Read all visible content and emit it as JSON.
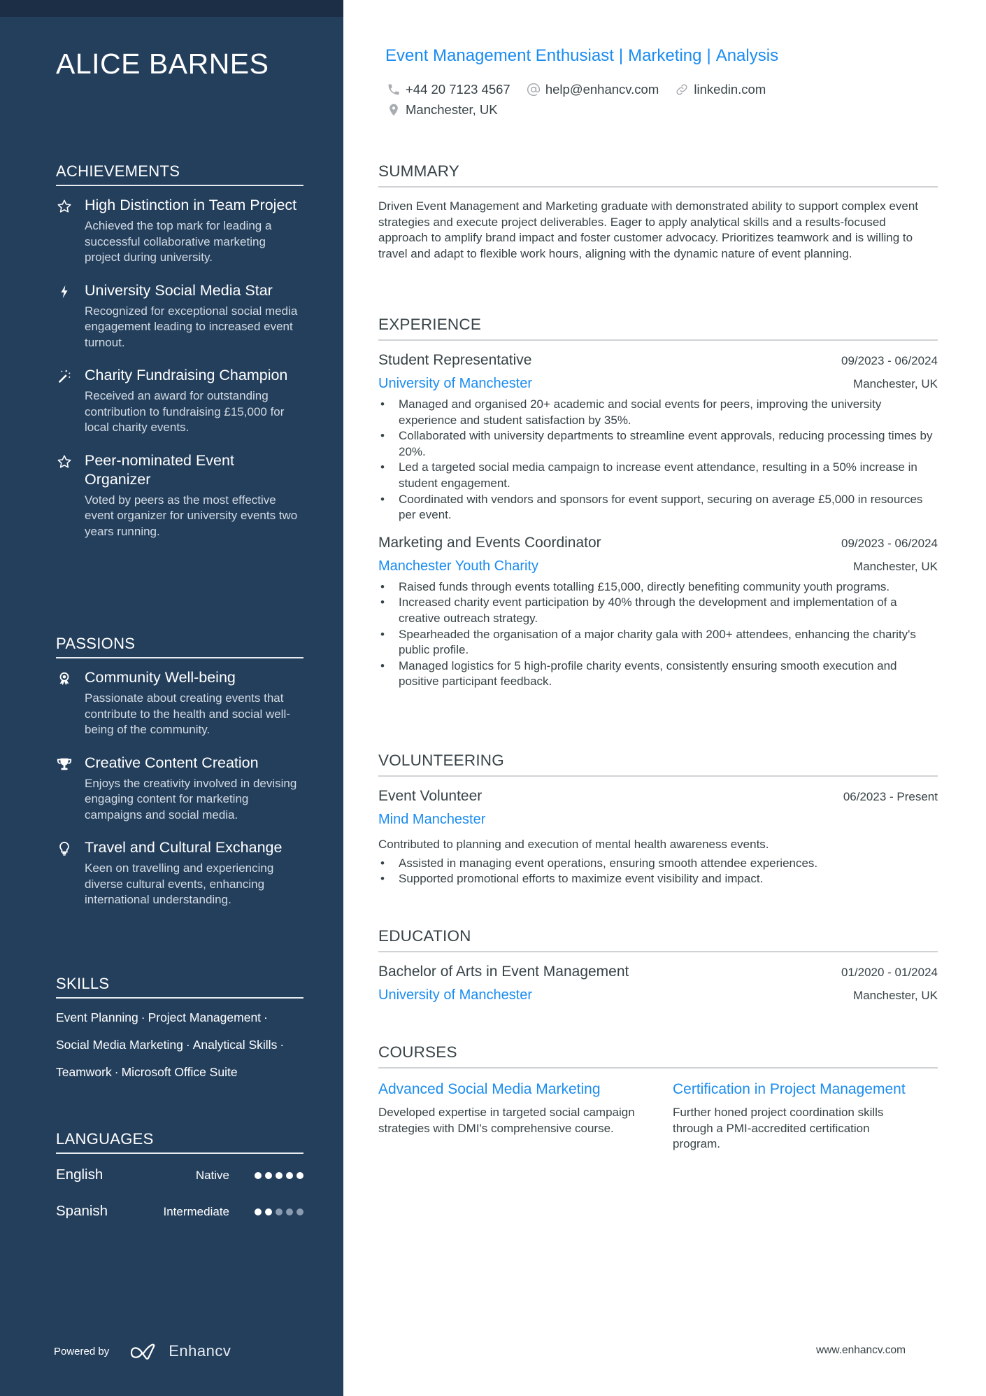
{
  "name": "ALICE BARNES",
  "headline": [
    "Event Management Enthusiast",
    "Marketing",
    "Analysis"
  ],
  "contacts": {
    "phone": "+44 20 7123 4567",
    "email": "help@enhancv.com",
    "link": "linkedin.com",
    "location": "Manchester, UK"
  },
  "sidebar": {
    "achievements": {
      "title": "ACHIEVEMENTS",
      "items": [
        {
          "icon": "star-icon",
          "title": "High Distinction in Team Project",
          "desc": "Achieved the top mark for leading a successful collaborative marketing project during university."
        },
        {
          "icon": "lightning-bolt-icon",
          "title": "University Social Media Star",
          "desc": "Recognized for exceptional social media engagement leading to increased event turnout."
        },
        {
          "icon": "magic-wand-icon",
          "title": "Charity Fundraising Champion",
          "desc": "Received an award for outstanding contribution to fundraising £15,000 for local charity events."
        },
        {
          "icon": "star-icon",
          "title": "Peer-nominated Event Organizer",
          "desc": "Voted by peers as the most effective event organizer for university events two years running."
        }
      ]
    },
    "passions": {
      "title": "PASSIONS",
      "items": [
        {
          "icon": "award-ribbon-icon",
          "title": "Community Well-being",
          "desc": "Passionate about creating events that contribute to the health and social well-being of the community."
        },
        {
          "icon": "trophy-icon",
          "title": "Creative Content Creation",
          "desc": "Enjoys the creativity involved in devising engaging content for marketing campaigns and social media."
        },
        {
          "icon": "lightbulb-icon",
          "title": "Travel and Cultural Exchange",
          "desc": "Keen on travelling and experiencing diverse cultural events, enhancing international understanding."
        }
      ]
    },
    "skills": {
      "title": "SKILLS",
      "items": [
        "Event Planning",
        "Project Management",
        "Social Media Marketing",
        "Analytical Skills",
        "Teamwork",
        "Microsoft Office Suite"
      ]
    },
    "languages": {
      "title": "LANGUAGES",
      "items": [
        {
          "name": "English",
          "level": "Native",
          "rating": 5,
          "max": 5
        },
        {
          "name": "Spanish",
          "level": "Intermediate",
          "rating": 2,
          "max": 5
        }
      ]
    },
    "powered_by": "Powered by",
    "brand": "Enhancv"
  },
  "main": {
    "summary": {
      "title": "SUMMARY",
      "text": "Driven Event Management and Marketing graduate with demonstrated ability to support complex event strategies and execute project deliverables. Eager to apply analytical skills and a results-focused approach to amplify brand impact and foster customer advocacy. Prioritizes teamwork and is willing to travel and adapt to flexible work hours, aligning with the dynamic nature of event planning."
    },
    "experience": {
      "title": "EXPERIENCE",
      "items": [
        {
          "role": "Student Representative",
          "dates": "09/2023 - 06/2024",
          "org": "University of Manchester",
          "location": "Manchester, UK",
          "bullets": [
            "Managed and organised 20+ academic and social events for peers, improving the university experience and student satisfaction by 35%.",
            "Collaborated with university departments to streamline event approvals, reducing processing times by 20%.",
            "Led a targeted social media campaign to increase event attendance, resulting in a 50% increase in student engagement.",
            "Coordinated with vendors and sponsors for event support, securing on average £5,000 in resources per event."
          ]
        },
        {
          "role": "Marketing and Events Coordinator",
          "dates": "09/2023 - 06/2024",
          "org": "Manchester Youth Charity",
          "location": "Manchester, UK",
          "bullets": [
            "Raised funds through events totalling £15,000, directly benefiting community youth programs.",
            "Increased charity event participation by 40% through the development and implementation of a creative outreach strategy.",
            "Spearheaded the organisation of a major charity gala with 200+ attendees, enhancing the charity's public profile.",
            "Managed logistics for 5 high-profile charity events, consistently ensuring smooth execution and positive participant feedback."
          ]
        }
      ]
    },
    "volunteering": {
      "title": "VOLUNTEERING",
      "items": [
        {
          "role": "Event Volunteer",
          "dates": "06/2023 - Present",
          "org": "Mind Manchester",
          "summary": "Contributed to planning and execution of mental health awareness events.",
          "bullets": [
            "Assisted in managing event operations, ensuring smooth attendee experiences.",
            "Supported promotional efforts to maximize event visibility and impact."
          ]
        }
      ]
    },
    "education": {
      "title": "EDUCATION",
      "items": [
        {
          "degree": "Bachelor of Arts in Event Management",
          "dates": "01/2020 - 01/2024",
          "school": "University of Manchester",
          "location": "Manchester, UK"
        }
      ]
    },
    "courses": {
      "title": "COURSES",
      "items": [
        {
          "title": "Advanced Social Media Marketing",
          "desc": "Developed expertise in targeted social campaign strategies with DMI's comprehensive course."
        },
        {
          "title": "Certification in Project Management",
          "desc": "Further honed project coordination skills through a PMI-accredited certification program."
        }
      ]
    }
  },
  "footer": {
    "url": "www.enhancv.com"
  },
  "colors": {
    "sidebar": "#243f5c",
    "topbar": "#1b2e45",
    "accent": "#1a8cf0",
    "text": "#384347"
  }
}
